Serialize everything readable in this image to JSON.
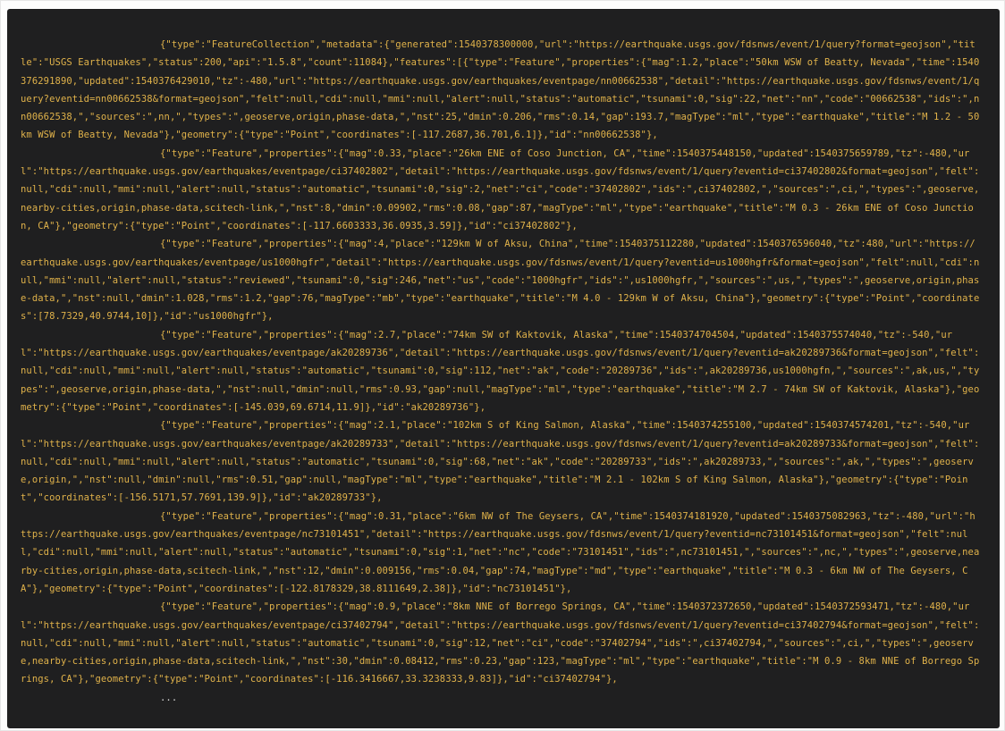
{
  "code": {
    "lines": [
      "{\"type\":\"FeatureCollection\",\"metadata\":{\"generated\":1540378300000,\"url\":\"https://earthquake.usgs.gov/fdsnws/event/1/query?format=geojson\",\"title\":\"USGS Earthquakes\",\"status\":200,\"api\":\"1.5.8\",\"count\":11084},\"features\":[{\"type\":\"Feature\",\"properties\":{\"mag\":1.2,\"place\":\"50km WSW of Beatty, Nevada\",\"time\":1540376291890,\"updated\":1540376429010,\"tz\":-480,\"url\":\"https://earthquake.usgs.gov/earthquakes/eventpage/nn00662538\",\"detail\":\"https://earthquake.usgs.gov/fdsnws/event/1/query?eventid=nn00662538&format=geojson\",\"felt\":null,\"cdi\":null,\"mmi\":null,\"alert\":null,\"status\":\"automatic\",\"tsunami\":0,\"sig\":22,\"net\":\"nn\",\"code\":\"00662538\",\"ids\":\",nn00662538,\",\"sources\":\",nn,\",\"types\":\",geoserve,origin,phase-data,\",\"nst\":25,\"dmin\":0.206,\"rms\":0.14,\"gap\":193.7,\"magType\":\"ml\",\"type\":\"earthquake\",\"title\":\"M 1.2 - 50km WSW of Beatty, Nevada\"},\"geometry\":{\"type\":\"Point\",\"coordinates\":[-117.2687,36.701,6.1]},\"id\":\"nn00662538\"},",
      "{\"type\":\"Feature\",\"properties\":{\"mag\":0.33,\"place\":\"26km ENE of Coso Junction, CA\",\"time\":1540375448150,\"updated\":1540375659789,\"tz\":-480,\"url\":\"https://earthquake.usgs.gov/earthquakes/eventpage/ci37402802\",\"detail\":\"https://earthquake.usgs.gov/fdsnws/event/1/query?eventid=ci37402802&format=geojson\",\"felt\":null,\"cdi\":null,\"mmi\":null,\"alert\":null,\"status\":\"automatic\",\"tsunami\":0,\"sig\":2,\"net\":\"ci\",\"code\":\"37402802\",\"ids\":\",ci37402802,\",\"sources\":\",ci,\",\"types\":\",geoserve,nearby-cities,origin,phase-data,scitech-link,\",\"nst\":8,\"dmin\":0.09902,\"rms\":0.08,\"gap\":87,\"magType\":\"ml\",\"type\":\"earthquake\",\"title\":\"M 0.3 - 26km ENE of Coso Junction, CA\"},\"geometry\":{\"type\":\"Point\",\"coordinates\":[-117.6603333,36.0935,3.59]},\"id\":\"ci37402802\"},",
      "{\"type\":\"Feature\",\"properties\":{\"mag\":4,\"place\":\"129km W of Aksu, China\",\"time\":1540375112280,\"updated\":1540376596040,\"tz\":480,\"url\":\"https://earthquake.usgs.gov/earthquakes/eventpage/us1000hgfr\",\"detail\":\"https://earthquake.usgs.gov/fdsnws/event/1/query?eventid=us1000hgfr&format=geojson\",\"felt\":null,\"cdi\":null,\"mmi\":null,\"alert\":null,\"status\":\"reviewed\",\"tsunami\":0,\"sig\":246,\"net\":\"us\",\"code\":\"1000hgfr\",\"ids\":\",us1000hgfr,\",\"sources\":\",us,\",\"types\":\",geoserve,origin,phase-data,\",\"nst\":null,\"dmin\":1.028,\"rms\":1.2,\"gap\":76,\"magType\":\"mb\",\"type\":\"earthquake\",\"title\":\"M 4.0 - 129km W of Aksu, China\"},\"geometry\":{\"type\":\"Point\",\"coordinates\":[78.7329,40.9744,10]},\"id\":\"us1000hgfr\"},",
      "{\"type\":\"Feature\",\"properties\":{\"mag\":2.7,\"place\":\"74km SW of Kaktovik, Alaska\",\"time\":1540374704504,\"updated\":1540375574040,\"tz\":-540,\"url\":\"https://earthquake.usgs.gov/earthquakes/eventpage/ak20289736\",\"detail\":\"https://earthquake.usgs.gov/fdsnws/event/1/query?eventid=ak20289736&format=geojson\",\"felt\":null,\"cdi\":null,\"mmi\":null,\"alert\":null,\"status\":\"automatic\",\"tsunami\":0,\"sig\":112,\"net\":\"ak\",\"code\":\"20289736\",\"ids\":\",ak20289736,us1000hgfn,\",\"sources\":\",ak,us,\",\"types\":\",geoserve,origin,phase-data,\",\"nst\":null,\"dmin\":null,\"rms\":0.93,\"gap\":null,\"magType\":\"ml\",\"type\":\"earthquake\",\"title\":\"M 2.7 - 74km SW of Kaktovik, Alaska\"},\"geometry\":{\"type\":\"Point\",\"coordinates\":[-145.039,69.6714,11.9]},\"id\":\"ak20289736\"},",
      "{\"type\":\"Feature\",\"properties\":{\"mag\":2.1,\"place\":\"102km S of King Salmon, Alaska\",\"time\":1540374255100,\"updated\":1540374574201,\"tz\":-540,\"url\":\"https://earthquake.usgs.gov/earthquakes/eventpage/ak20289733\",\"detail\":\"https://earthquake.usgs.gov/fdsnws/event/1/query?eventid=ak20289733&format=geojson\",\"felt\":null,\"cdi\":null,\"mmi\":null,\"alert\":null,\"status\":\"automatic\",\"tsunami\":0,\"sig\":68,\"net\":\"ak\",\"code\":\"20289733\",\"ids\":\",ak20289733,\",\"sources\":\",ak,\",\"types\":\",geoserve,origin,\",\"nst\":null,\"dmin\":null,\"rms\":0.51,\"gap\":null,\"magType\":\"ml\",\"type\":\"earthquake\",\"title\":\"M 2.1 - 102km S of King Salmon, Alaska\"},\"geometry\":{\"type\":\"Point\",\"coordinates\":[-156.5171,57.7691,139.9]},\"id\":\"ak20289733\"},",
      "{\"type\":\"Feature\",\"properties\":{\"mag\":0.31,\"place\":\"6km NW of The Geysers, CA\",\"time\":1540374181920,\"updated\":1540375082963,\"tz\":-480,\"url\":\"https://earthquake.usgs.gov/earthquakes/eventpage/nc73101451\",\"detail\":\"https://earthquake.usgs.gov/fdsnws/event/1/query?eventid=nc73101451&format=geojson\",\"felt\":null,\"cdi\":null,\"mmi\":null,\"alert\":null,\"status\":\"automatic\",\"tsunami\":0,\"sig\":1,\"net\":\"nc\",\"code\":\"73101451\",\"ids\":\",nc73101451,\",\"sources\":\",nc,\",\"types\":\",geoserve,nearby-cities,origin,phase-data,scitech-link,\",\"nst\":12,\"dmin\":0.009156,\"rms\":0.04,\"gap\":74,\"magType\":\"md\",\"type\":\"earthquake\",\"title\":\"M 0.3 - 6km NW of The Geysers, CA\"},\"geometry\":{\"type\":\"Point\",\"coordinates\":[-122.8178329,38.8111649,2.38]},\"id\":\"nc73101451\"},",
      "{\"type\":\"Feature\",\"properties\":{\"mag\":0.9,\"place\":\"8km NNE of Borrego Springs, CA\",\"time\":1540372372650,\"updated\":1540372593471,\"tz\":-480,\"url\":\"https://earthquake.usgs.gov/earthquakes/eventpage/ci37402794\",\"detail\":\"https://earthquake.usgs.gov/fdsnws/event/1/query?eventid=ci37402794&format=geojson\",\"felt\":null,\"cdi\":null,\"mmi\":null,\"alert\":null,\"status\":\"automatic\",\"tsunami\":0,\"sig\":12,\"net\":\"ci\",\"code\":\"37402794\",\"ids\":\",ci37402794,\",\"sources\":\",ci,\",\"types\":\",geoserve,nearby-cities,origin,phase-data,scitech-link,\",\"nst\":30,\"dmin\":0.08412,\"rms\":0.23,\"gap\":123,\"magType\":\"ml\",\"type\":\"earthquake\",\"title\":\"M 0.9 - 8km NNE of Borrego Springs, CA\"},\"geometry\":{\"type\":\"Point\",\"coordinates\":[-116.3416667,33.3238333,9.83]},\"id\":\"ci37402794\"},"
    ],
    "ellipsis": "..."
  },
  "colors": {
    "panel_background": "#1f1f20",
    "key_text": "#e0b24a",
    "string_text": "#dcdcdc"
  }
}
